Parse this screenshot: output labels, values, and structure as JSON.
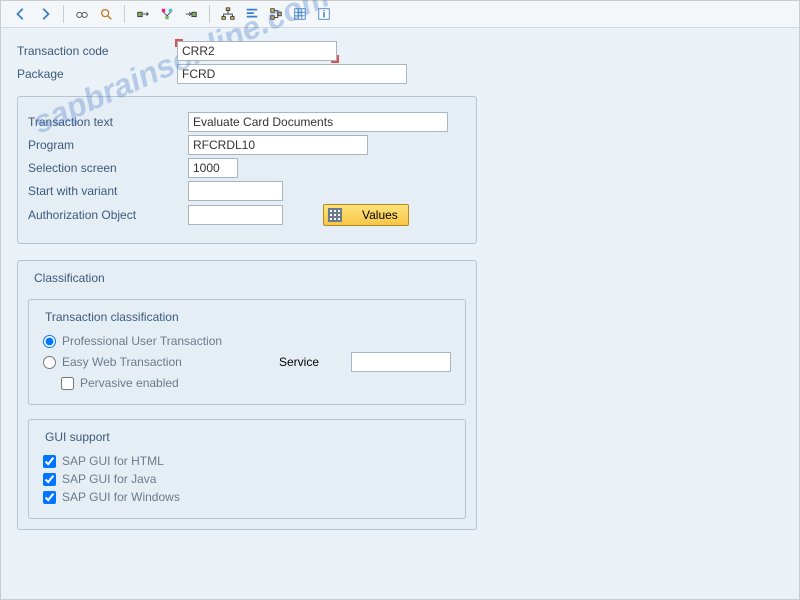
{
  "toolbar": {
    "icons": [
      "back",
      "forward",
      "execute",
      "find",
      "find-next",
      "first",
      "prev",
      "next",
      "tree",
      "align",
      "collapse",
      "table",
      "info"
    ]
  },
  "header": {
    "tcode_label": "Transaction code",
    "tcode_value": "CRR2",
    "package_label": "Package",
    "package_value": "FCRD"
  },
  "details": {
    "text_label": "Transaction text",
    "text_value": "Evaluate Card Documents",
    "program_label": "Program",
    "program_value": "RFCRDL10",
    "selscreen_label": "Selection screen",
    "selscreen_value": "1000",
    "variant_label": "Start with variant",
    "variant_value": "",
    "authobj_label": "Authorization Object",
    "authobj_value": "",
    "values_label": "Values"
  },
  "classification": {
    "title": "Classification",
    "tc_title": "Transaction classification",
    "prof": "Professional User Transaction",
    "easy": "Easy Web Transaction",
    "service_label": "Service",
    "service_value": "",
    "pervasive": "Pervasive enabled",
    "gui_title": "GUI support",
    "gui_html": "SAP GUI for HTML",
    "gui_java": "SAP GUI for Java",
    "gui_win": "SAP GUI for Windows"
  },
  "watermark": "sapbrainsonline.com"
}
